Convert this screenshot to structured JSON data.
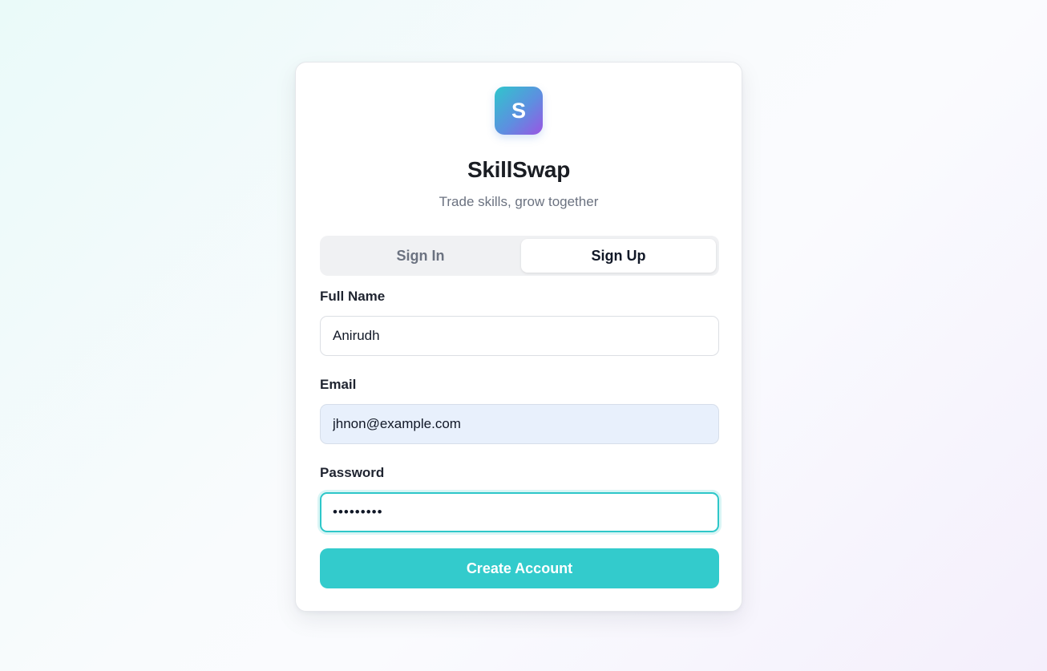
{
  "brand": {
    "logo_letter": "S",
    "name": "SkillSwap",
    "tagline": "Trade skills, grow together"
  },
  "tabs": {
    "items": [
      {
        "label": "Sign In",
        "active": false
      },
      {
        "label": "Sign Up",
        "active": true
      }
    ]
  },
  "form": {
    "full_name": {
      "label": "Full Name",
      "value": "Anirudh"
    },
    "email": {
      "label": "Email",
      "value": "jhnon@example.com"
    },
    "password": {
      "label": "Password",
      "value": "password1",
      "focused": true
    },
    "submit_label": "Create Account"
  },
  "colors": {
    "accent": "#33cbcc",
    "focus_ring": "#2ec7c9",
    "logo_gradient_start": "#2fc6cc",
    "logo_gradient_end": "#9a55e3",
    "autofill_bg": "#e8f0fc"
  }
}
